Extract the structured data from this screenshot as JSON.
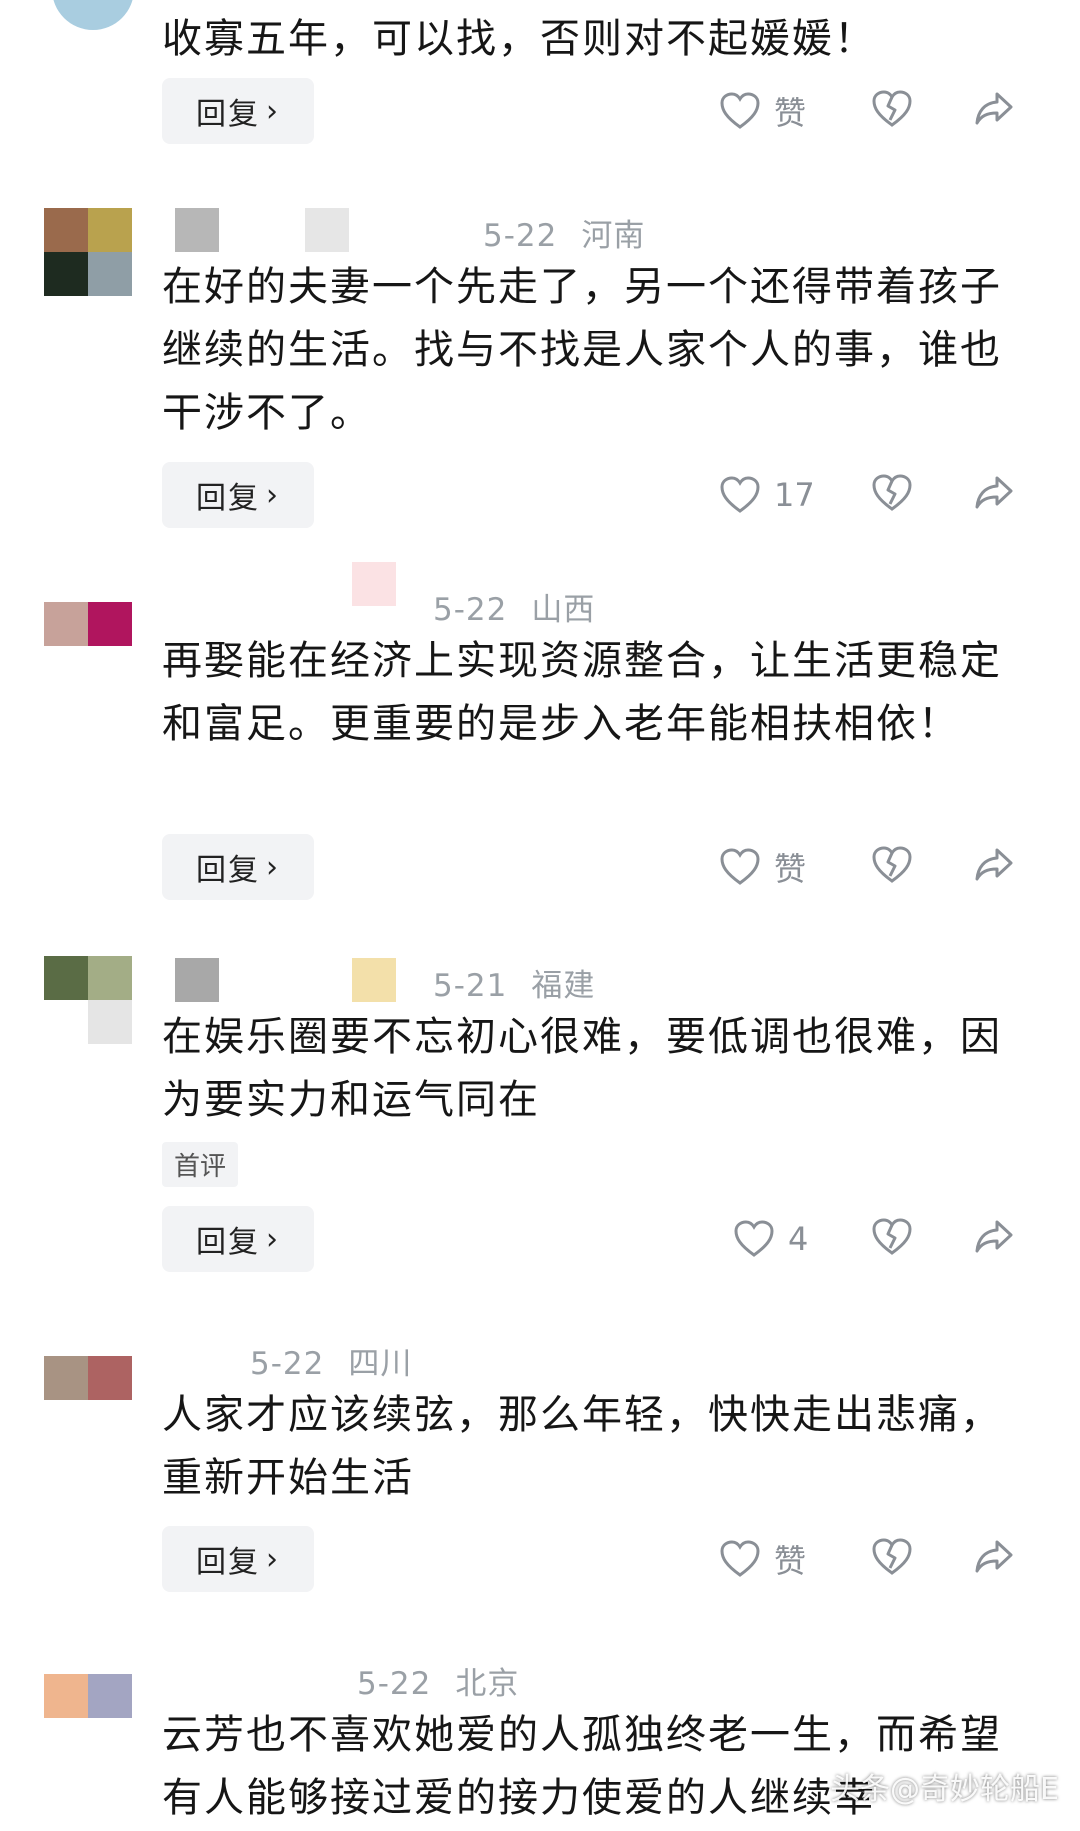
{
  "comments": [
    {
      "meta": {
        "date": "",
        "location": ""
      },
      "text": "收寡五年，可以找，否则对不起媛媛！",
      "tag": "",
      "reply_label": "回复",
      "like_label": "赞"
    },
    {
      "meta": {
        "date": "5-22",
        "location": "河南"
      },
      "text": "在好的夫妻一个先走了，另一个还得带着孩子继续的生活。找与不找是人家个人的事，谁也干涉不了。",
      "tag": "",
      "reply_label": "回复",
      "like_label": "17"
    },
    {
      "meta": {
        "date": "5-22",
        "location": "山西"
      },
      "text": "再娶能在经济上实现资源整合，让生活更稳定和富足。更重要的是步入老年能相扶相依！",
      "tag": "",
      "reply_label": "回复",
      "like_label": "赞"
    },
    {
      "meta": {
        "date": "5-21",
        "location": "福建"
      },
      "text": "在娱乐圈要不忘初心很难，要低调也很难，因为要实力和运气同在",
      "tag": "首评",
      "reply_label": "回复",
      "like_label": "4"
    },
    {
      "meta": {
        "date": "5-22",
        "location": "四川"
      },
      "text": "人家才应该续弦，那么年轻，快快走出悲痛，重新开始生活",
      "tag": "",
      "reply_label": "回复",
      "like_label": "赞"
    },
    {
      "meta": {
        "date": "5-22",
        "location": "北京"
      },
      "text": "云芳也不喜欢她爱的人孤独终老一生，而希望有人能够接过爱的接力使爱的人继续幸",
      "tag": "",
      "reply_label": "",
      "like_label": ""
    }
  ],
  "icons": {
    "like": "heart-outline-icon",
    "dislike": "broken-heart-icon",
    "share": "share-arrow-icon",
    "reply_chevron": "chevron-right-icon"
  },
  "colors": {
    "text": "#161616",
    "meta": "#9aa0a6",
    "button_bg": "#f2f3f5",
    "icon": "#8a8f96"
  },
  "watermark": "头条@奇妙轮船E"
}
